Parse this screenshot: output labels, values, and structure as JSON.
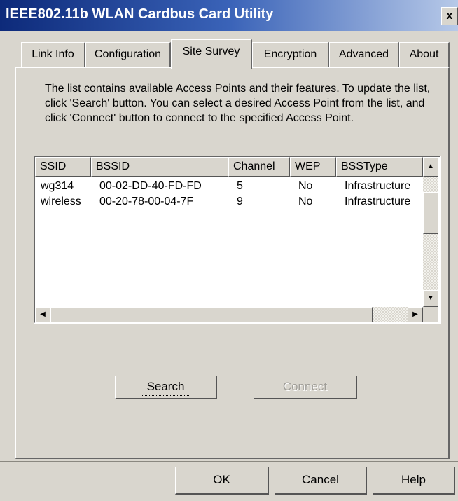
{
  "window": {
    "title": "IEEE802.11b WLAN Cardbus Card Utility",
    "close_symbol": "x"
  },
  "tabs": [
    {
      "label": "Link Info"
    },
    {
      "label": "Configuration"
    },
    {
      "label": "Site Survey",
      "active": true
    },
    {
      "label": "Encryption"
    },
    {
      "label": "Advanced"
    },
    {
      "label": "About"
    }
  ],
  "site_survey": {
    "description": "The list contains available Access Points and their features. To update the list, click 'Search' button. You can select a desired Access Point from the list, and click 'Connect' button to connect to the specified Access Point.",
    "columns": [
      "SSID",
      "BSSID",
      "Channel",
      "WEP",
      "BSSType"
    ],
    "rows": [
      [
        "wg314",
        "00-02-DD-40-FD-FD",
        "5",
        "No",
        "Infrastructure"
      ],
      [
        "wireless",
        "00-20-78-00-04-7F",
        "9",
        "No",
        "Infrastructure"
      ]
    ],
    "search_label": "Search",
    "connect_label": "Connect",
    "connect_enabled": false
  },
  "footer": {
    "ok_label": "OK",
    "cancel_label": "Cancel",
    "help_label": "Help"
  },
  "colors": {
    "titlebar_start": "#0d2a7a",
    "titlebar_end": "#b7c9e8",
    "dialog_bg": "#d9d6ce",
    "list_bg": "#ffffff"
  }
}
